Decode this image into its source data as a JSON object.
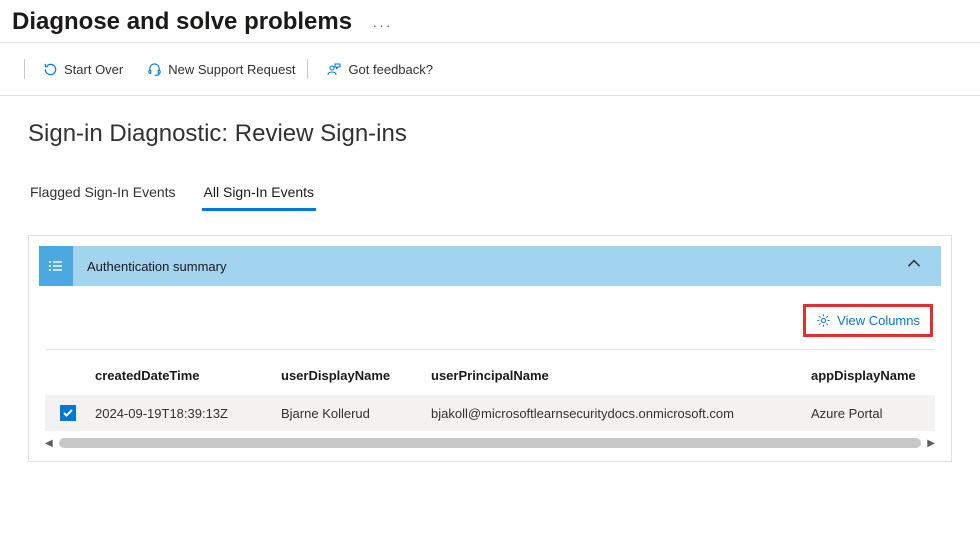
{
  "header": {
    "title": "Diagnose and solve problems",
    "more": "···"
  },
  "toolbar": {
    "start_over": "Start Over",
    "new_support": "New Support Request",
    "feedback": "Got feedback?"
  },
  "section": {
    "title": "Sign-in Diagnostic: Review Sign-ins"
  },
  "tabs": {
    "flagged": "Flagged Sign-In Events",
    "all": "All Sign-In Events"
  },
  "summary": {
    "label": "Authentication summary"
  },
  "actions": {
    "view_columns": "View Columns"
  },
  "table": {
    "columns": {
      "created": "createdDateTime",
      "user": "userDisplayName",
      "upn": "userPrincipalName",
      "app": "appDisplayName"
    },
    "rows": [
      {
        "created": "2024-09-19T18:39:13Z",
        "user": "Bjarne Kollerud",
        "upn": "bjakoll@microsoftlearnsecuritydocs.onmicrosoft.com",
        "app": "Azure Portal"
      }
    ]
  }
}
